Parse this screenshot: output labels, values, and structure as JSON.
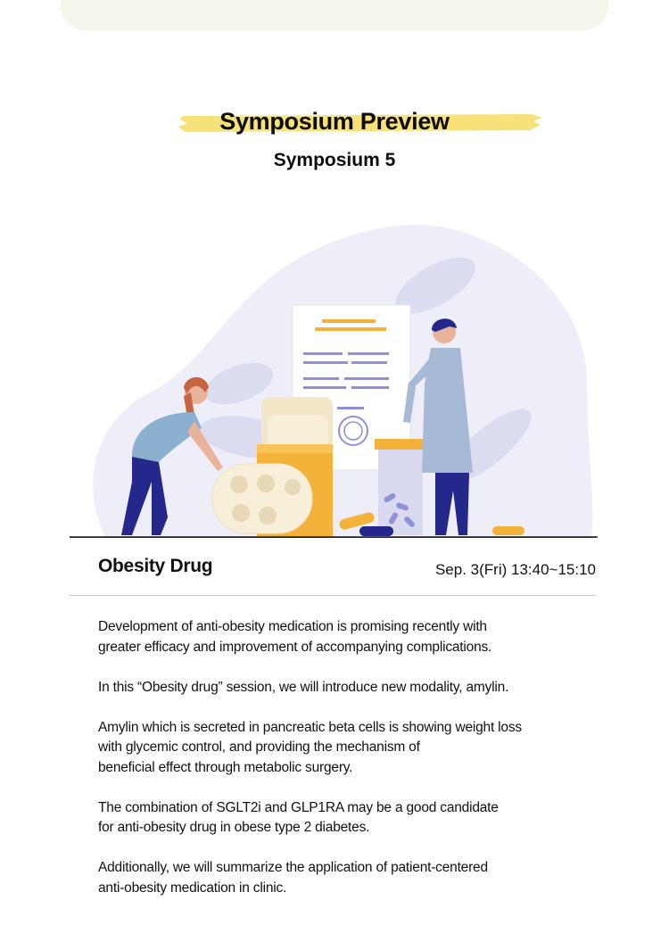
{
  "heading": {
    "title": "Symposium Preview",
    "subtitle": "Symposium 5"
  },
  "session": {
    "name": "Obesity Drug",
    "time": "Sep. 3(Fri) 13:40~15:10"
  },
  "paragraphs": [
    [
      "Development of anti-obesity medication is promising recently with",
      "greater efficacy and improvement of accompanying complications."
    ],
    [
      "In this “Obesity drug” session, we will introduce new modality, amylin."
    ],
    [
      "Amylin which is secreted in pancreatic beta cells is showing weight loss",
      "with glycemic control, and providing the mechanism of",
      "beneficial effect through metabolic surgery."
    ],
    [
      "The combination of SGLT2i and GLP1RA may be a good candidate",
      "for anti-obesity drug in obese type 2 diabetes."
    ],
    [
      "Additionally, we will summarize the application of patient-centered",
      "anti-obesity medication in clinic."
    ]
  ],
  "colors": {
    "highlight": "#f7e27a",
    "blob": "#eeeef8",
    "accent_orange": "#f3b23a",
    "navy": "#23288a"
  }
}
